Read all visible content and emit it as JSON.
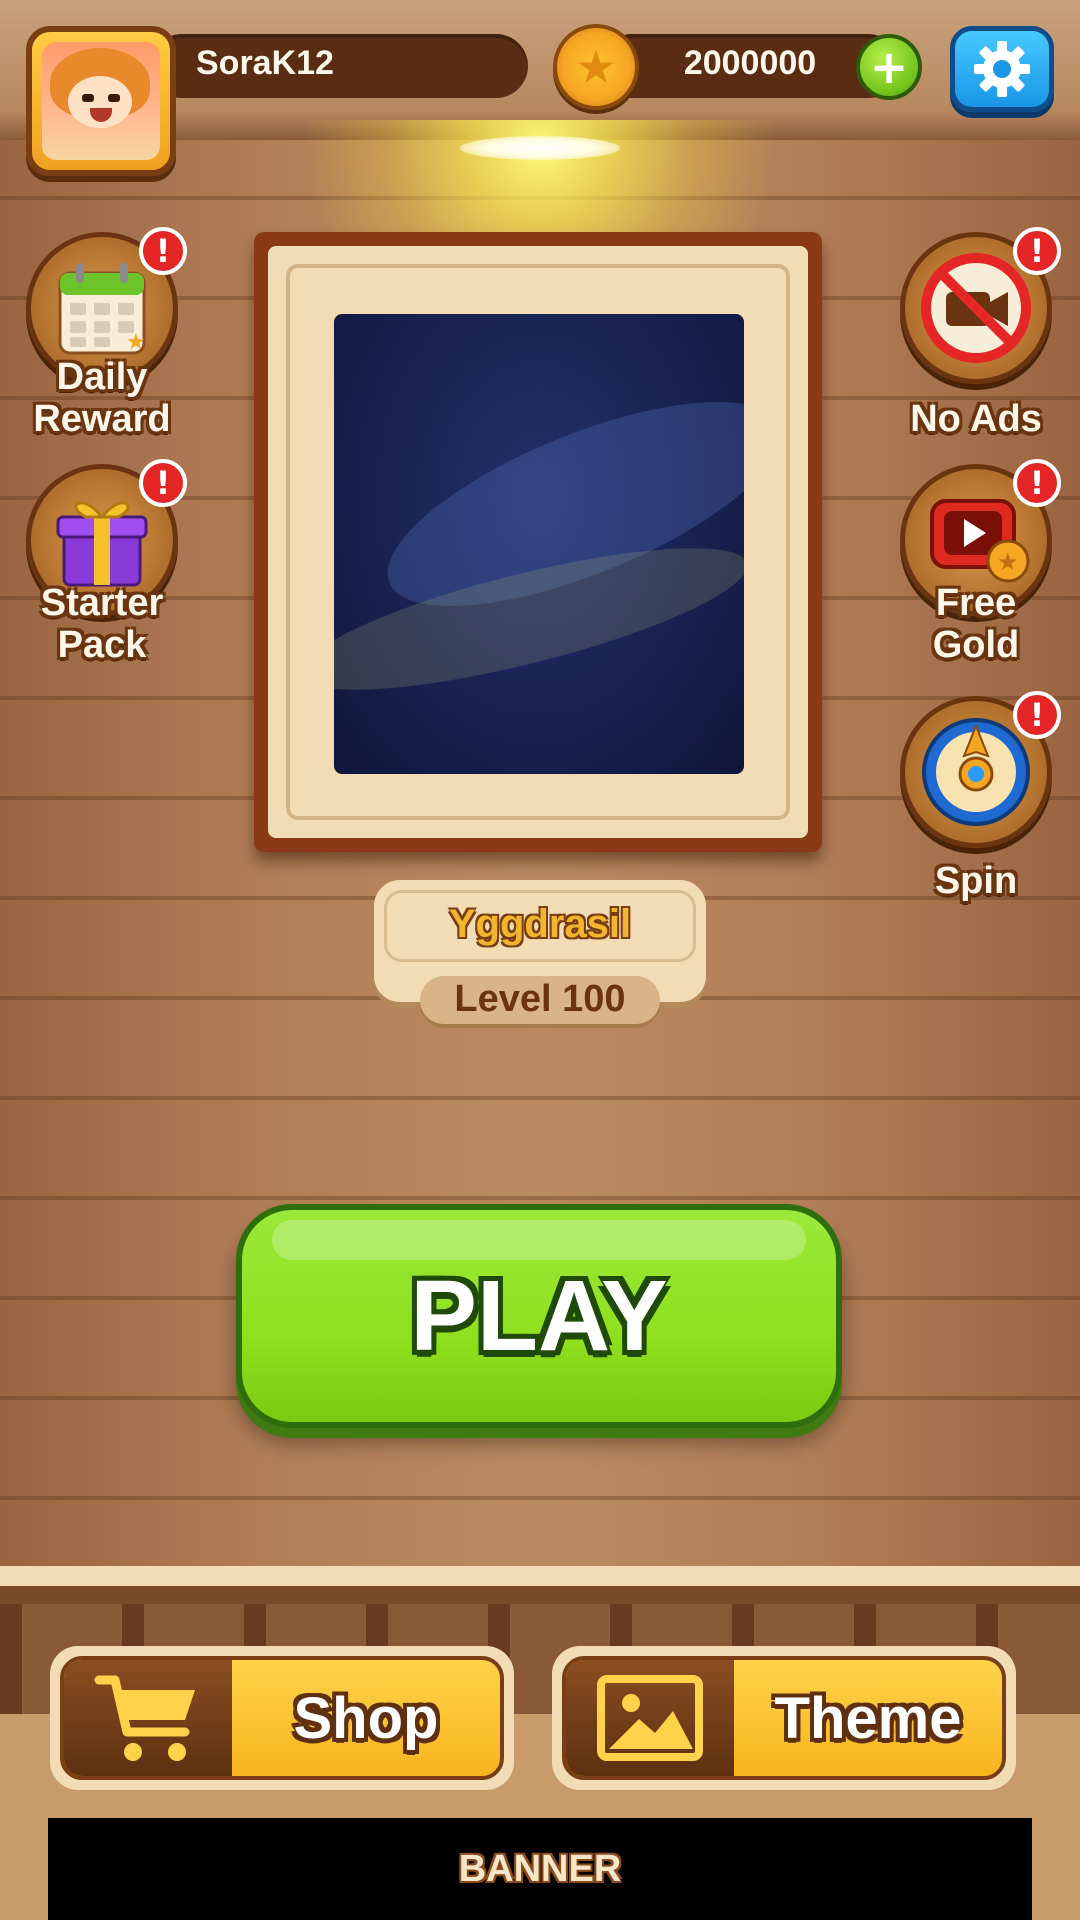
{
  "player": {
    "name": "SoraK12",
    "gold": "2000000"
  },
  "header": {
    "add_gold_icon": "plus-icon",
    "settings_icon": "gear-icon"
  },
  "left_menu": [
    {
      "label_line1": "Daily",
      "label_line2": "Reward",
      "icon": "calendar-icon",
      "badge": "!"
    },
    {
      "label_line1": "Starter",
      "label_line2": "Pack",
      "icon": "gift-icon",
      "badge": "!"
    }
  ],
  "right_menu": [
    {
      "label_line1": "No Ads",
      "label_line2": "",
      "icon": "no-video-icon",
      "badge": "!"
    },
    {
      "label_line1": "Free",
      "label_line2": "Gold",
      "icon": "video-coin-icon",
      "badge": "!"
    },
    {
      "label_line1": "Spin",
      "label_line2": "",
      "icon": "wheel-icon",
      "badge": "!"
    }
  ],
  "level": {
    "name": "Yggdrasil",
    "label": "Level 100"
  },
  "play_label": "PLAY",
  "bottom_tabs": {
    "shop": {
      "label": "Shop",
      "icon": "cart-icon"
    },
    "theme": {
      "label": "Theme",
      "icon": "image-icon"
    }
  },
  "banner": "BANNER",
  "colors": {
    "accent_green": "#8fe01e",
    "gold": "#f7b51e",
    "wood": "#b27e57",
    "badge_red": "#e52626",
    "settings_blue": "#1996e6"
  }
}
